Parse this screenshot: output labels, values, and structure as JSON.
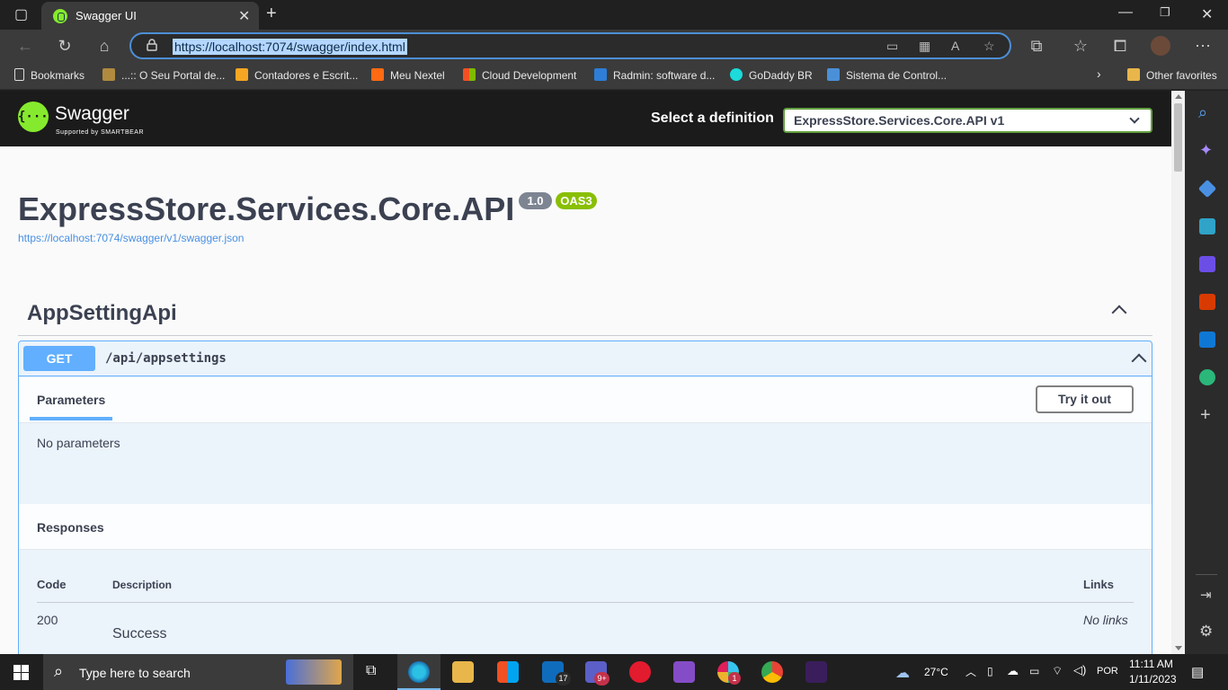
{
  "browser": {
    "tab_title": "Swagger UI",
    "url": "https://localhost:7074/swagger/index.html",
    "bookmarks": [
      {
        "label": "Bookmarks",
        "icon": "bookmark-page-icon",
        "color": "#dddddd"
      },
      {
        "label": "...:: O Seu Portal de...",
        "icon": "portal-icon",
        "color": "#b08a3e"
      },
      {
        "label": "Contadores e Escrit...",
        "icon": "gplus-icon",
        "color": "#f5a623"
      },
      {
        "label": "Meu Nextel",
        "icon": "nextel-icon",
        "color": "#ff6a13"
      },
      {
        "label": "Cloud Development",
        "icon": "microsoft-icon",
        "color": "#f25022"
      },
      {
        "label": "Radmin: software d...",
        "icon": "radmin-icon",
        "color": "#2e7dd7"
      },
      {
        "label": "GoDaddy BR",
        "icon": "godaddy-icon",
        "color": "#1bdbdb"
      },
      {
        "label": "Sistema de Control...",
        "icon": "sistema-icon",
        "color": "#4a90d9"
      }
    ],
    "other_favorites": "Other favorites"
  },
  "swagger": {
    "brand": "Swagger",
    "brand_sub": "Supported by SMARTBEAR",
    "select_label": "Select a definition",
    "selected_definition": "ExpressStore.Services.Core.API v1",
    "api_title": "ExpressStore.Services.Core.API",
    "version": "1.0",
    "oas": "OAS3",
    "spec_url": "https://localhost:7074/swagger/v1/swagger.json",
    "tag": "AppSettingApi",
    "operation": {
      "method": "GET",
      "path": "/api/appsettings",
      "parameters_title": "Parameters",
      "try_it_out": "Try it out",
      "no_parameters": "No parameters",
      "responses_title": "Responses",
      "columns": {
        "code": "Code",
        "description": "Description",
        "links": "Links"
      },
      "responses": [
        {
          "code": "200",
          "description": "Success",
          "links": "No links"
        }
      ]
    }
  },
  "taskbar": {
    "search_placeholder": "Type here to search",
    "temperature": "27°C",
    "language": "POR",
    "time": "11:11 AM",
    "date": "1/11/2023",
    "mail_badge": "17",
    "teams_badge": "9+",
    "slack_badge": "1"
  }
}
